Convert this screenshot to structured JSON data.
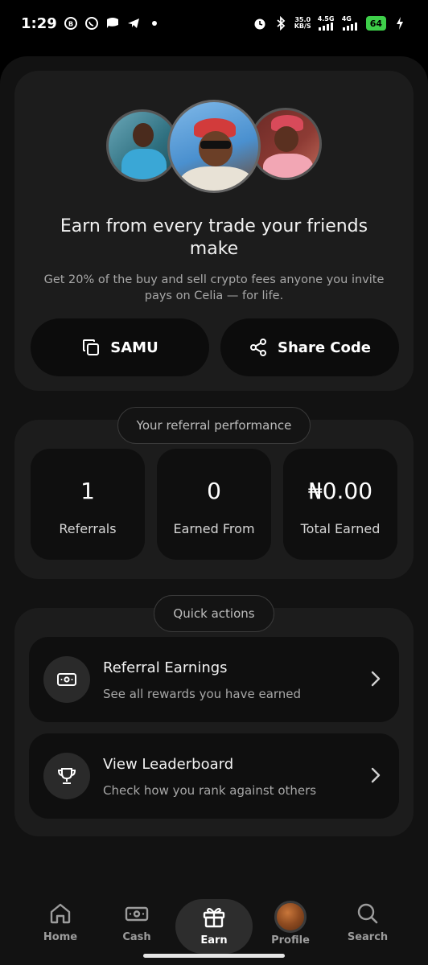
{
  "status_bar": {
    "time": "1:29",
    "net_speed_value": "35.0",
    "net_speed_unit": "KB/S",
    "signal1_label": "4.5G",
    "signal2_label": "4G",
    "battery": "64"
  },
  "hero": {
    "title": "Earn from every trade your friends make",
    "subtitle": "Get 20% of the buy and sell crypto fees anyone you invite pays on Celia — for life.",
    "code_label": "SAMU",
    "share_label": "Share Code"
  },
  "performance": {
    "chip_label": "Your referral performance",
    "stats": [
      {
        "value": "1",
        "label": "Referrals"
      },
      {
        "value": "0",
        "label": "Earned From"
      },
      {
        "value": "₦0.00",
        "label": "Total Earned"
      }
    ]
  },
  "quick_actions": {
    "chip_label": "Quick actions",
    "items": [
      {
        "title": "Referral Earnings",
        "subtitle": "See all rewards you have earned",
        "icon": "cash-icon"
      },
      {
        "title": "View Leaderboard",
        "subtitle": "Check how you rank against others",
        "icon": "trophy-icon"
      }
    ]
  },
  "bottom_nav": {
    "items": [
      {
        "label": "Home",
        "icon": "home-icon"
      },
      {
        "label": "Cash",
        "icon": "cash-icon"
      },
      {
        "label": "Earn",
        "icon": "gift-icon",
        "active": true
      },
      {
        "label": "Profile",
        "icon": "avatar"
      },
      {
        "label": "Search",
        "icon": "search-icon"
      }
    ]
  },
  "colors": {
    "background": "#121212",
    "card": "#1c1c1c",
    "inner_card": "#0f0f0f",
    "battery": "#3ecf4a"
  }
}
